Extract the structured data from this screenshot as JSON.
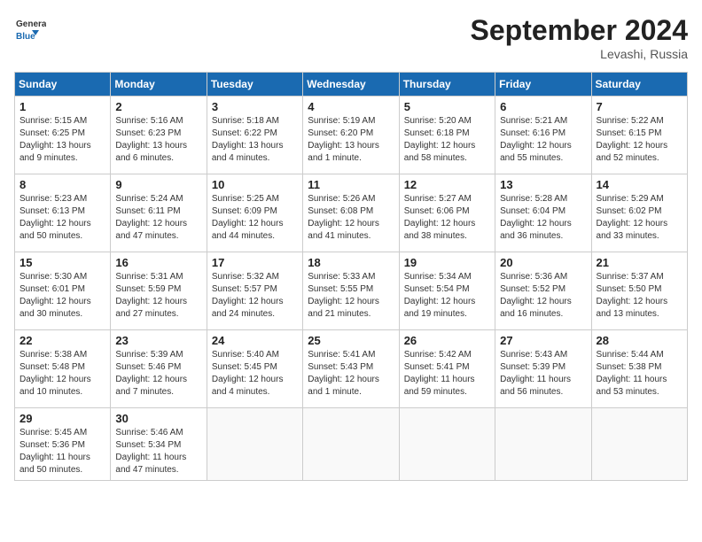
{
  "logo": {
    "line1": "General",
    "line2": "Blue"
  },
  "title": "September 2024",
  "location": "Levashi, Russia",
  "weekdays": [
    "Sunday",
    "Monday",
    "Tuesday",
    "Wednesday",
    "Thursday",
    "Friday",
    "Saturday"
  ],
  "weeks": [
    [
      {
        "day": "1",
        "sunrise": "5:15 AM",
        "sunset": "6:25 PM",
        "daylight": "13 hours and 9 minutes."
      },
      {
        "day": "2",
        "sunrise": "5:16 AM",
        "sunset": "6:23 PM",
        "daylight": "13 hours and 6 minutes."
      },
      {
        "day": "3",
        "sunrise": "5:18 AM",
        "sunset": "6:22 PM",
        "daylight": "13 hours and 4 minutes."
      },
      {
        "day": "4",
        "sunrise": "5:19 AM",
        "sunset": "6:20 PM",
        "daylight": "13 hours and 1 minute."
      },
      {
        "day": "5",
        "sunrise": "5:20 AM",
        "sunset": "6:18 PM",
        "daylight": "12 hours and 58 minutes."
      },
      {
        "day": "6",
        "sunrise": "5:21 AM",
        "sunset": "6:16 PM",
        "daylight": "12 hours and 55 minutes."
      },
      {
        "day": "7",
        "sunrise": "5:22 AM",
        "sunset": "6:15 PM",
        "daylight": "12 hours and 52 minutes."
      }
    ],
    [
      {
        "day": "8",
        "sunrise": "5:23 AM",
        "sunset": "6:13 PM",
        "daylight": "12 hours and 50 minutes."
      },
      {
        "day": "9",
        "sunrise": "5:24 AM",
        "sunset": "6:11 PM",
        "daylight": "12 hours and 47 minutes."
      },
      {
        "day": "10",
        "sunrise": "5:25 AM",
        "sunset": "6:09 PM",
        "daylight": "12 hours and 44 minutes."
      },
      {
        "day": "11",
        "sunrise": "5:26 AM",
        "sunset": "6:08 PM",
        "daylight": "12 hours and 41 minutes."
      },
      {
        "day": "12",
        "sunrise": "5:27 AM",
        "sunset": "6:06 PM",
        "daylight": "12 hours and 38 minutes."
      },
      {
        "day": "13",
        "sunrise": "5:28 AM",
        "sunset": "6:04 PM",
        "daylight": "12 hours and 36 minutes."
      },
      {
        "day": "14",
        "sunrise": "5:29 AM",
        "sunset": "6:02 PM",
        "daylight": "12 hours and 33 minutes."
      }
    ],
    [
      {
        "day": "15",
        "sunrise": "5:30 AM",
        "sunset": "6:01 PM",
        "daylight": "12 hours and 30 minutes."
      },
      {
        "day": "16",
        "sunrise": "5:31 AM",
        "sunset": "5:59 PM",
        "daylight": "12 hours and 27 minutes."
      },
      {
        "day": "17",
        "sunrise": "5:32 AM",
        "sunset": "5:57 PM",
        "daylight": "12 hours and 24 minutes."
      },
      {
        "day": "18",
        "sunrise": "5:33 AM",
        "sunset": "5:55 PM",
        "daylight": "12 hours and 21 minutes."
      },
      {
        "day": "19",
        "sunrise": "5:34 AM",
        "sunset": "5:54 PM",
        "daylight": "12 hours and 19 minutes."
      },
      {
        "day": "20",
        "sunrise": "5:36 AM",
        "sunset": "5:52 PM",
        "daylight": "12 hours and 16 minutes."
      },
      {
        "day": "21",
        "sunrise": "5:37 AM",
        "sunset": "5:50 PM",
        "daylight": "12 hours and 13 minutes."
      }
    ],
    [
      {
        "day": "22",
        "sunrise": "5:38 AM",
        "sunset": "5:48 PM",
        "daylight": "12 hours and 10 minutes."
      },
      {
        "day": "23",
        "sunrise": "5:39 AM",
        "sunset": "5:46 PM",
        "daylight": "12 hours and 7 minutes."
      },
      {
        "day": "24",
        "sunrise": "5:40 AM",
        "sunset": "5:45 PM",
        "daylight": "12 hours and 4 minutes."
      },
      {
        "day": "25",
        "sunrise": "5:41 AM",
        "sunset": "5:43 PM",
        "daylight": "12 hours and 1 minute."
      },
      {
        "day": "26",
        "sunrise": "5:42 AM",
        "sunset": "5:41 PM",
        "daylight": "11 hours and 59 minutes."
      },
      {
        "day": "27",
        "sunrise": "5:43 AM",
        "sunset": "5:39 PM",
        "daylight": "11 hours and 56 minutes."
      },
      {
        "day": "28",
        "sunrise": "5:44 AM",
        "sunset": "5:38 PM",
        "daylight": "11 hours and 53 minutes."
      }
    ],
    [
      {
        "day": "29",
        "sunrise": "5:45 AM",
        "sunset": "5:36 PM",
        "daylight": "11 hours and 50 minutes."
      },
      {
        "day": "30",
        "sunrise": "5:46 AM",
        "sunset": "5:34 PM",
        "daylight": "11 hours and 47 minutes."
      },
      null,
      null,
      null,
      null,
      null
    ]
  ]
}
